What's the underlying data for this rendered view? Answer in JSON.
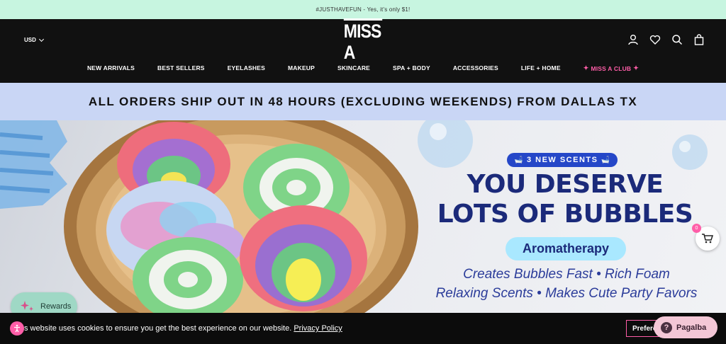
{
  "announcement": {
    "text": "#JUSTHAVEFUN - Yes, it's only $1!"
  },
  "header": {
    "currency": "USD",
    "logo_text": "MISS A",
    "icons": [
      "account-icon",
      "heart-icon",
      "search-icon",
      "bag-icon"
    ]
  },
  "nav": {
    "items": [
      "NEW ARRIVALS",
      "BEST SELLERS",
      "EYELASHES",
      "MAKEUP",
      "SKINCARE",
      "SPA + BODY",
      "ACCESSORIES",
      "LIFE + HOME"
    ],
    "club": "MISS A CLUB",
    "club_color": "#ff5ea8"
  },
  "shipping_banner": {
    "text": "ALL ORDERS SHIP OUT IN 48  HOURS (EXCLUDING WEEKENDS) FROM DALLAS TX"
  },
  "hero": {
    "badge": "3 NEW SCENTS",
    "headline_line1": "YOU DESERVE",
    "headline_line2": "LOTS OF BUBBLES",
    "pill": "Aromatherapy",
    "feature_line1": "Creates Bubbles Fast • Rich Foam",
    "feature_line2": "Relaxing Scents • Makes Cute Party Favors",
    "headline_color": "#1b2a7a",
    "badge_color": "#2547c8"
  },
  "cart_widget": {
    "count": "0"
  },
  "rewards": {
    "label": "Rewards"
  },
  "cookie": {
    "message": "s website uses cookies to ensure you get the best experience on our website.",
    "policy_link": "Privacy Policy",
    "preferences": "Prefere"
  },
  "help": {
    "label": "Pagalba"
  }
}
